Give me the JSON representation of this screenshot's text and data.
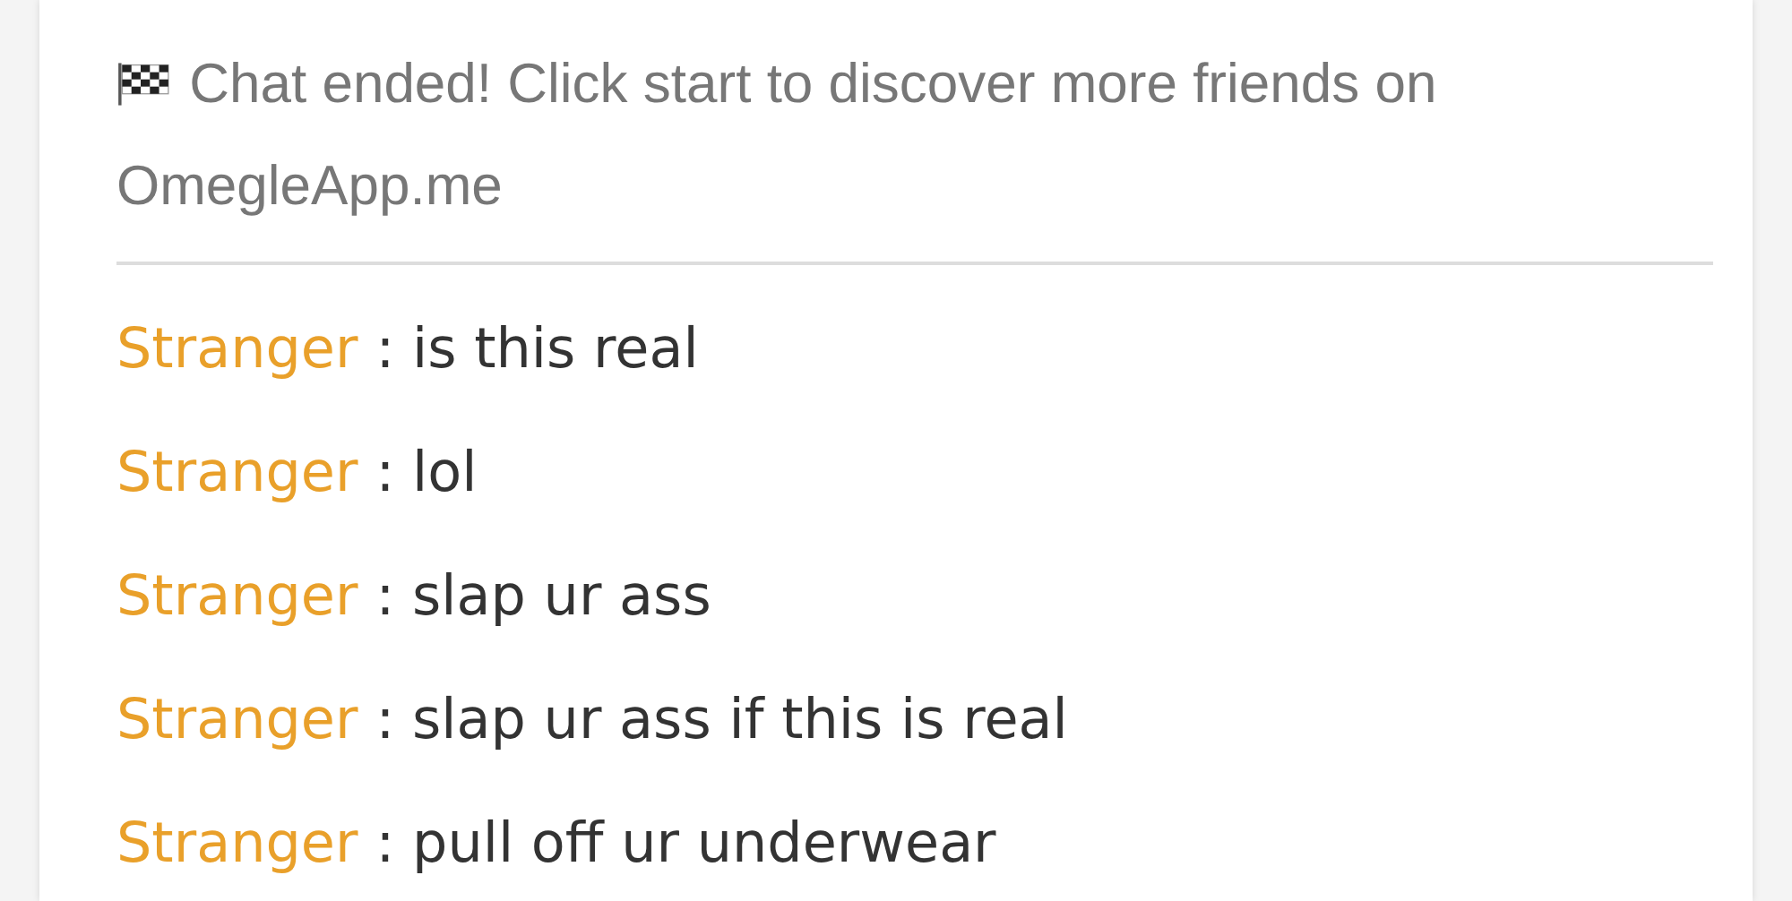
{
  "notice": {
    "text": "Chat ended! Click start to discover more friends on OmegleApp.me"
  },
  "messages": [
    {
      "sender": "Stranger",
      "text": ": is this real"
    },
    {
      "sender": "Stranger",
      "text": ": lol"
    },
    {
      "sender": "Stranger",
      "text": ": slap ur ass"
    },
    {
      "sender": "Stranger",
      "text": ": slap ur ass if this is real"
    },
    {
      "sender": "Stranger",
      "text": ": pull off ur underwear"
    }
  ]
}
